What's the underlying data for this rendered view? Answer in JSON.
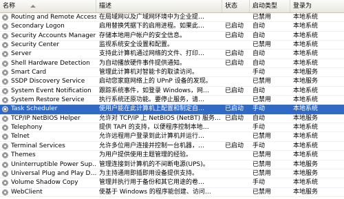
{
  "columns": {
    "name": "名称",
    "description": "描述",
    "status": "状态",
    "startup_type": "启动类型",
    "logon_as": "登录为"
  },
  "services": [
    {
      "name": "Routing and Remote Access",
      "description": "在局域网以及广域网环境中为企业提…",
      "status": "",
      "startup": "已禁用",
      "logon": "本地系统"
    },
    {
      "name": "Secondary Logon",
      "description": "启用替换凭据下的启用进程。如果此…",
      "status": "已启动",
      "startup": "自动",
      "logon": "本地系统"
    },
    {
      "name": "Security Accounts Manager",
      "description": "存储本地用户帐户的安全信息。",
      "status": "已启动",
      "startup": "自动",
      "logon": "本地系统"
    },
    {
      "name": "Security Center",
      "description": "监视系统安全设置和配置。",
      "status": "",
      "startup": "已禁用",
      "logon": "本地系统"
    },
    {
      "name": "Server",
      "description": "支持此计算机通过网络的文件、打印…",
      "status": "已启动",
      "startup": "自动",
      "logon": "本地系统"
    },
    {
      "name": "Shell Hardware Detection",
      "description": "为自动播放硬件事件提供通知。",
      "status": "已启动",
      "startup": "自动",
      "logon": "本地系统"
    },
    {
      "name": "Smart Card",
      "description": "管理此计算机对智能卡的取读访问。",
      "status": "",
      "startup": "手动",
      "logon": "本地服务"
    },
    {
      "name": "SSDP Discovery Service",
      "description": "启动您家庭网络上的 UPnP 设备的发现。",
      "status": "",
      "startup": "已禁用",
      "logon": "本地服务"
    },
    {
      "name": "System Event Notification",
      "description": "跟踪系统事件，如登录 Windows，网…",
      "status": "已启动",
      "startup": "自动",
      "logon": "本地系统"
    },
    {
      "name": "System Restore Service",
      "description": "执行系统还原功能。要停止服务，请…",
      "status": "",
      "startup": "已禁用",
      "logon": "本地系统"
    },
    {
      "name": "Task Scheduler",
      "description": "使用户能在此计算机上配置和制定自…",
      "status": "已启动",
      "startup": "手动",
      "logon": "本地系统",
      "selected": true
    },
    {
      "name": "TCP/IP NetBIOS Helper",
      "description": "允许对 TCP/IP 上 NetBIOS (NetBT) 服务…",
      "status": "已启动",
      "startup": "自动",
      "logon": "本地服务"
    },
    {
      "name": "Telephony",
      "description": "提供 TAPI 的支持，以便程序控制本地…",
      "status": "",
      "startup": "手动",
      "logon": "本地系统"
    },
    {
      "name": "Telnet",
      "description": "允许远程用户登录到此计算机并运行…",
      "status": "",
      "startup": "已禁用",
      "logon": "本地系统"
    },
    {
      "name": "Terminal Services",
      "description": "允许多位用户连接并控制一台机器，…",
      "status": "已启动",
      "startup": "手动",
      "logon": "本地系统"
    },
    {
      "name": "Themes",
      "description": "为用户提供使用主题管理的经验。",
      "status": "",
      "startup": "已禁用",
      "logon": "本地系统"
    },
    {
      "name": "Uninterruptible Power Sup…",
      "description": "管理连接到计算机的不间断电源(UPS)。",
      "status": "",
      "startup": "已禁用",
      "logon": "本地服务"
    },
    {
      "name": "Universal Plug and Play D…",
      "description": "为主持通用即插即用设备提供支持。",
      "status": "",
      "startup": "已禁用",
      "logon": "本地服务"
    },
    {
      "name": "Volume Shadow Copy",
      "description": "管理并执行用于备份和其它用途的卷…",
      "status": "",
      "startup": "手动",
      "logon": "本地系统"
    },
    {
      "name": "WebClient",
      "description": "使基于 Windows 的程序能创建、访问…",
      "status": "",
      "startup": "已禁用",
      "logon": "本地服务"
    }
  ]
}
